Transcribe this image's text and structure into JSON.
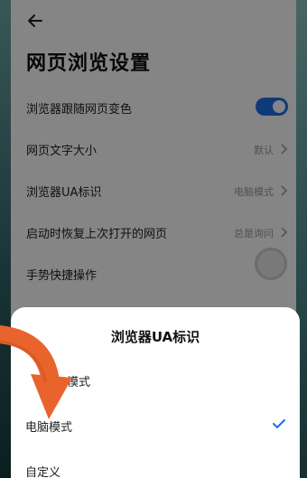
{
  "colors": {
    "accent": "#1e6fe8",
    "pointer_arrow": "#e8642c",
    "overlay": "rgba(0,0,0,0.48)"
  },
  "header": {
    "back_icon": "back-arrow-icon",
    "title": "网页浏览设置"
  },
  "settings": {
    "items": [
      {
        "label": "浏览器跟随网页变色",
        "control": "toggle",
        "toggle_on": true
      },
      {
        "label": "网页文字大小",
        "value": "默认"
      },
      {
        "label": "浏览器UA标识",
        "value": "电脑模式"
      },
      {
        "label": "启动时恢复上次打开的网页",
        "value": "总是询问"
      },
      {
        "label": "手势快捷操作"
      }
    ]
  },
  "sheet": {
    "title": "浏览器UA标识",
    "options": [
      {
        "label": "模式",
        "selected": false
      },
      {
        "label": "电脑模式",
        "selected": true
      },
      {
        "label": "自定义",
        "selected": false
      }
    ],
    "check_icon": "checkmark-icon"
  }
}
